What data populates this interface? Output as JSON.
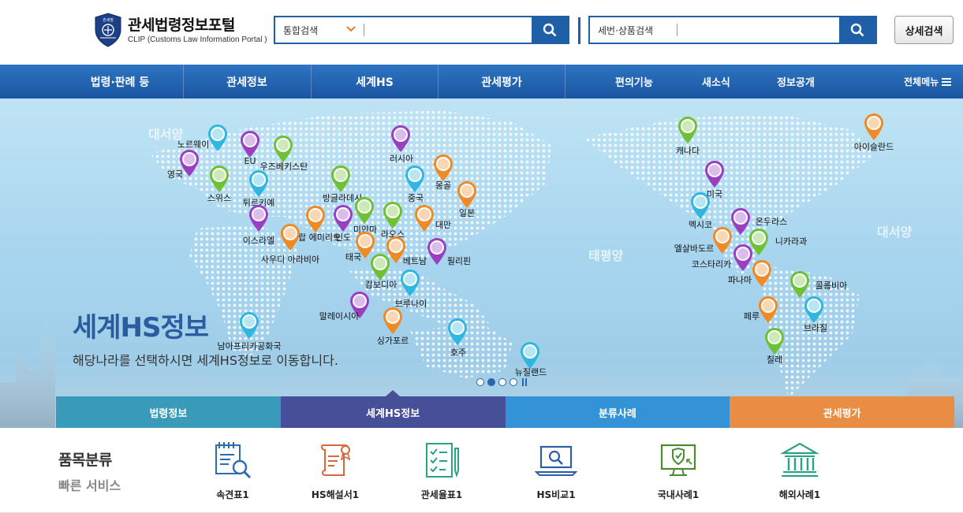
{
  "header": {
    "logo_title": "관세법령정보포털",
    "logo_sub": "CLIP (Customs Law Information Portal )",
    "emblem_text": "관세청",
    "search1": {
      "select_label": "통합검색",
      "value": "",
      "placeholder": ""
    },
    "search2": {
      "label": "세번·상품검색",
      "value": "",
      "placeholder": ""
    },
    "detail_search": "상세검색"
  },
  "nav": {
    "main": [
      "법령·판례 등",
      "관세정보",
      "세계HS",
      "관세평가"
    ],
    "sub": [
      "편의기능",
      "새소식",
      "정보공개"
    ],
    "all_menu": "전체메뉴"
  },
  "hero": {
    "title": "세계HS정보",
    "desc": "해당나라를 선택하시면 세계HS정보로 이동합니다.",
    "oceans": [
      "대서양",
      "태평양",
      "대서양"
    ],
    "countries": [
      "노르웨이",
      "EU",
      "우즈베키스탄",
      "영국",
      "스위스",
      "튀르키예",
      "러시아",
      "몽골",
      "방글라데시",
      "중국",
      "일본",
      "이스라엘",
      "아랍 에미리트",
      "인도",
      "미얀마",
      "라오스",
      "대만",
      "사우디 아라비아",
      "태국",
      "베트남",
      "필리핀",
      "캄보디아",
      "브루나이",
      "말레이시아",
      "싱가포르",
      "호주",
      "남아프리카공화국",
      "뉴질랜드",
      "캐나다",
      "아이슬란드",
      "미국",
      "멕시코",
      "온두라스",
      "엘살바도르",
      "니카라과",
      "코스타리카",
      "파나마",
      "콜롬비아",
      "페루",
      "브라질",
      "칠레"
    ],
    "slider": {
      "count": 4,
      "active": 1
    },
    "tabs": [
      {
        "label": "법령정보",
        "color": "#3a9ab9"
      },
      {
        "label": "세계HS정보",
        "color": "#474f99"
      },
      {
        "label": "분류사례",
        "color": "#3393d6"
      },
      {
        "label": "관세평가",
        "color": "#e98d45"
      }
    ]
  },
  "quick": {
    "title": "품목분류",
    "subtitle": "빠른 서비스",
    "items": [
      {
        "label": "속견표1",
        "icon": "table-search-icon",
        "color": "#2a6db3"
      },
      {
        "label": "HS해설서1",
        "icon": "scroll-certificate-icon",
        "color": "#d9673a"
      },
      {
        "label": "관세율표1",
        "icon": "checklist-icon",
        "color": "#2aa37f"
      },
      {
        "label": "HS비교1",
        "icon": "laptop-search-icon",
        "color": "#2a5ea8"
      },
      {
        "label": "국내사례1",
        "icon": "monitor-shield-icon",
        "color": "#4c8a2f"
      },
      {
        "label": "해외사례1",
        "icon": "institution-icon",
        "color": "#2aa37f"
      }
    ]
  }
}
